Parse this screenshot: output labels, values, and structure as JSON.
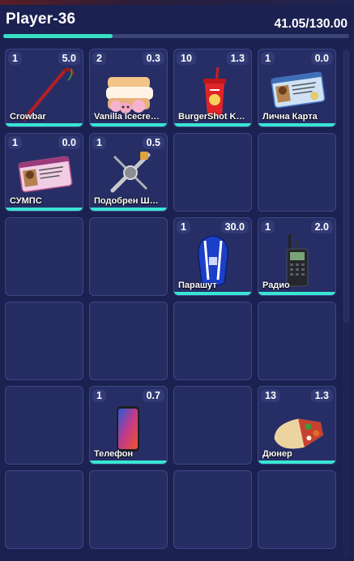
{
  "header": {
    "title": "Player-36",
    "weight": "41.05/130.00",
    "weight_fill_fraction": 0.316
  },
  "colors": {
    "background": "#1b2150",
    "slot": "#262d63",
    "accent": "#39e0c6"
  },
  "slots": [
    {
      "qty": "1",
      "weight": "5.0",
      "name": "Crowbar",
      "icon": "crowbar-icon"
    },
    {
      "qty": "2",
      "weight": "0.3",
      "name": "Vanilla Icecre…",
      "icon": "ice-cream-sandwich-icon"
    },
    {
      "qty": "10",
      "weight": "1.3",
      "name": "BurgerShot K…",
      "icon": "soda-cup-icon"
    },
    {
      "qty": "1",
      "weight": "0.0",
      "name": "Лична Карта",
      "icon": "id-card-icon"
    },
    {
      "qty": "1",
      "weight": "0.0",
      "name": "СУМПС",
      "icon": "license-card-icon"
    },
    {
      "qty": "1",
      "weight": "0.5",
      "name": "Подобрен Ш…",
      "icon": "lockpick-icon"
    },
    null,
    null,
    null,
    null,
    {
      "qty": "1",
      "weight": "30.0",
      "name": "Парашут",
      "icon": "parachute-icon"
    },
    {
      "qty": "1",
      "weight": "2.0",
      "name": "Радио",
      "icon": "radio-icon"
    },
    null,
    null,
    null,
    null,
    null,
    {
      "qty": "1",
      "weight": "0.7",
      "name": "Телефон",
      "icon": "phone-icon"
    },
    null,
    {
      "qty": "13",
      "weight": "1.3",
      "name": "Дюнер",
      "icon": "doner-wrap-icon"
    },
    null,
    null,
    null,
    null
  ]
}
